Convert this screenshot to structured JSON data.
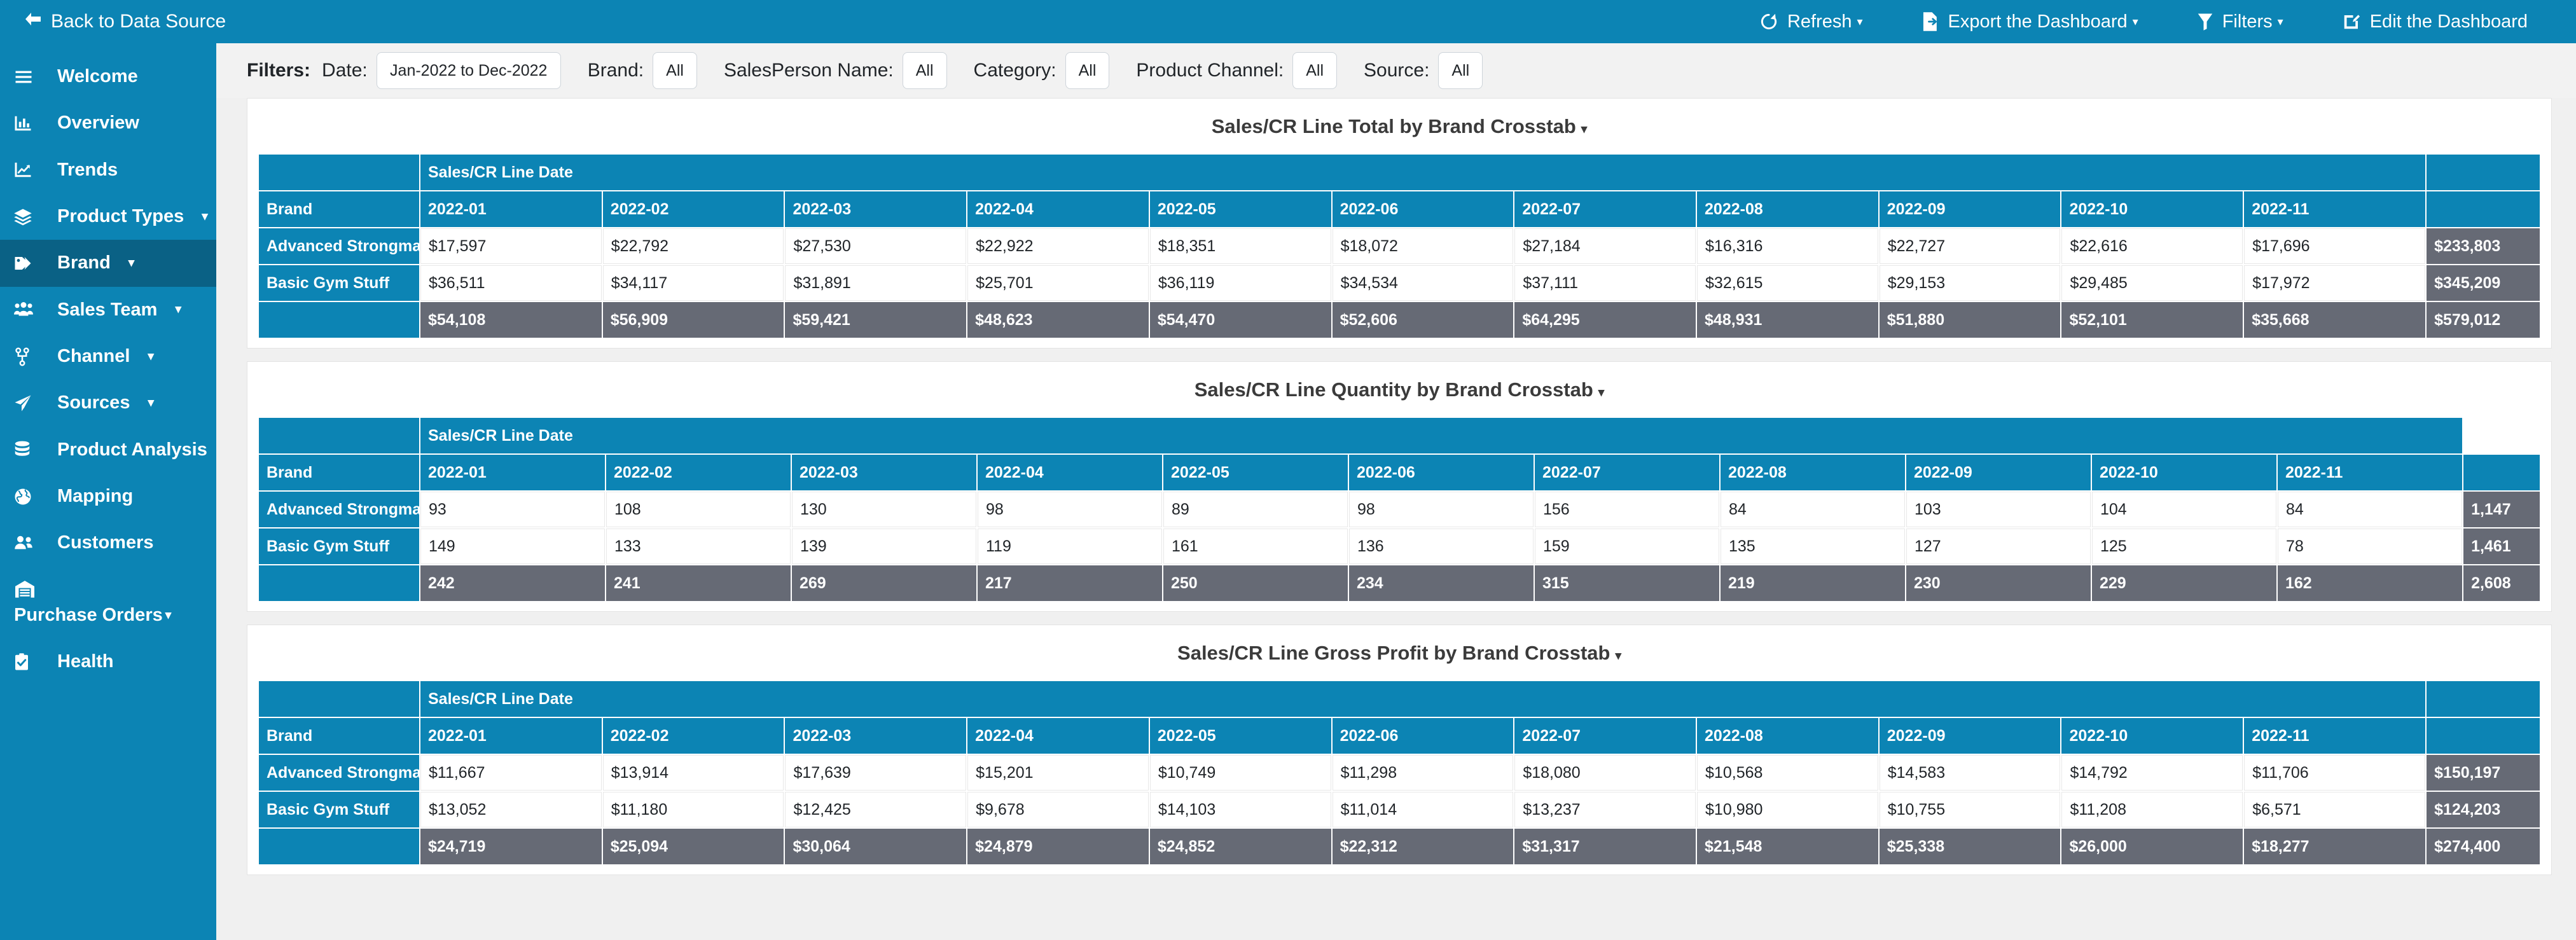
{
  "topbar": {
    "back_label": "Back to Data Source",
    "back_icon": "arrow-left-icon",
    "actions": [
      {
        "label": "Refresh",
        "icon": "refresh-icon",
        "caret": "▾"
      },
      {
        "label": "Export the Dashboard",
        "icon": "export-file-icon",
        "caret": "▾"
      },
      {
        "label": "Filters",
        "icon": "funnel-icon",
        "caret": "▾"
      },
      {
        "label": "Edit the Dashboard",
        "icon": "edit-pencil-icon",
        "caret": ""
      }
    ]
  },
  "sidebar": {
    "items": [
      {
        "label": "Welcome",
        "icon": "hamburger-icon",
        "caret": "",
        "active": false
      },
      {
        "label": "Overview",
        "icon": "bar-chart-icon",
        "caret": "",
        "active": false
      },
      {
        "label": "Trends",
        "icon": "line-chart-icon",
        "caret": "",
        "active": false
      },
      {
        "label": "Product Types",
        "icon": "layers-icon",
        "caret": "▾",
        "active": false
      },
      {
        "label": "Brand",
        "icon": "tag-icon",
        "caret": "▾",
        "active": true
      },
      {
        "label": "Sales Team",
        "icon": "users-group-icon",
        "caret": "▾",
        "active": false
      },
      {
        "label": "Channel",
        "icon": "sitemap-icon",
        "caret": "▾",
        "active": false
      },
      {
        "label": "Sources",
        "icon": "paper-plane-icon",
        "caret": "▾",
        "active": false
      },
      {
        "label": "Product Analysis",
        "icon": "database-icon",
        "caret": "",
        "active": false
      },
      {
        "label": "Mapping",
        "icon": "globe-icon",
        "caret": "",
        "active": false
      },
      {
        "label": "Customers",
        "icon": "users-icon",
        "caret": "",
        "active": false
      },
      {
        "label": "Purchase Orders",
        "icon": "warehouse-icon",
        "caret": "▾",
        "active": false,
        "wrap": true
      },
      {
        "label": "Health",
        "icon": "clipboard-check-icon",
        "caret": "",
        "active": false
      }
    ]
  },
  "filters": {
    "title": "Filters:",
    "items": [
      {
        "label": "Date:",
        "value": "Jan-2022 to Dec-2022",
        "wide": true
      },
      {
        "label": "Brand:",
        "value": "All",
        "wide": false
      },
      {
        "label": "SalesPerson Name:",
        "value": "All",
        "wide": false
      },
      {
        "label": "Category:",
        "value": "All",
        "wide": false
      },
      {
        "label": "Product Channel:",
        "value": "All",
        "wide": false
      },
      {
        "label": "Source:",
        "value": "All",
        "wide": false
      }
    ]
  },
  "colors": {
    "brand_blue": "#0c84b4",
    "sidebar_active": "#0a6185",
    "total_gray": "#666a75",
    "page_bg": "#f0f0f0"
  },
  "chart_data": [
    {
      "type": "table",
      "title": "Sales/CR Line Total by Brand Crosstab",
      "caret": "▾",
      "group_header": "Sales/CR Line Date",
      "row_header_label": "Brand",
      "categories": [
        "2022-01",
        "2022-02",
        "2022-03",
        "2022-04",
        "2022-05",
        "2022-06",
        "2022-07",
        "2022-08",
        "2022-09",
        "2022-10",
        "2022-11"
      ],
      "total_header": "",
      "series": [
        {
          "name": "Advanced Strongman",
          "values": [
            "$17,597",
            "$22,792",
            "$27,530",
            "$22,922",
            "$18,351",
            "$18,072",
            "$27,184",
            "$16,316",
            "$22,727",
            "$22,616",
            "$17,696"
          ],
          "total": "$233,803"
        },
        {
          "name": "Basic Gym Stuff",
          "values": [
            "$36,511",
            "$34,117",
            "$31,891",
            "$25,701",
            "$36,119",
            "$34,534",
            "$37,111",
            "$32,615",
            "$29,153",
            "$29,485",
            "$17,972"
          ],
          "total": "$345,209"
        }
      ],
      "totals_row": {
        "name": "",
        "values": [
          "$54,108",
          "$56,909",
          "$59,421",
          "$48,623",
          "$54,470",
          "$52,606",
          "$64,295",
          "$48,931",
          "$51,880",
          "$52,101",
          "$35,668"
        ],
        "total": "$579,012"
      }
    },
    {
      "type": "table",
      "title": "Sales/CR Line Quantity by Brand Crosstab",
      "caret": "▾",
      "group_header": "Sales/CR Line Date",
      "row_header_label": "Brand",
      "categories": [
        "2022-01",
        "2022-02",
        "2022-03",
        "2022-04",
        "2022-05",
        "2022-06",
        "2022-07",
        "2022-08",
        "2022-09",
        "2022-10",
        "2022-11"
      ],
      "total_header": "",
      "series": [
        {
          "name": "Advanced Strongman",
          "values": [
            "93",
            "108",
            "130",
            "98",
            "89",
            "98",
            "156",
            "84",
            "103",
            "104",
            "84"
          ],
          "total": "1,147"
        },
        {
          "name": "Basic Gym Stuff",
          "values": [
            "149",
            "133",
            "139",
            "119",
            "161",
            "136",
            "159",
            "135",
            "127",
            "125",
            "78"
          ],
          "total": "1,461"
        }
      ],
      "totals_row": {
        "name": "",
        "values": [
          "242",
          "241",
          "269",
          "217",
          "250",
          "234",
          "315",
          "219",
          "230",
          "229",
          "162"
        ],
        "total": "2,608"
      }
    },
    {
      "type": "table",
      "title": "Sales/CR Line Gross Profit by Brand Crosstab",
      "caret": "▾",
      "group_header": "Sales/CR Line Date",
      "row_header_label": "Brand",
      "categories": [
        "2022-01",
        "2022-02",
        "2022-03",
        "2022-04",
        "2022-05",
        "2022-06",
        "2022-07",
        "2022-08",
        "2022-09",
        "2022-10",
        "2022-11"
      ],
      "total_header": "",
      "series": [
        {
          "name": "Advanced Strongman",
          "values": [
            "$11,667",
            "$13,914",
            "$17,639",
            "$15,201",
            "$10,749",
            "$11,298",
            "$18,080",
            "$10,568",
            "$14,583",
            "$14,792",
            "$11,706"
          ],
          "total": "$150,197"
        },
        {
          "name": "Basic Gym Stuff",
          "values": [
            "$13,052",
            "$11,180",
            "$12,425",
            "$9,678",
            "$14,103",
            "$11,014",
            "$13,237",
            "$10,980",
            "$10,755",
            "$11,208",
            "$6,571"
          ],
          "total": "$124,203"
        }
      ],
      "totals_row": {
        "name": "",
        "values": [
          "$24,719",
          "$25,094",
          "$30,064",
          "$24,879",
          "$24,852",
          "$22,312",
          "$31,317",
          "$21,548",
          "$25,338",
          "$26,000",
          "$18,277"
        ],
        "total": "$274,400"
      }
    }
  ]
}
